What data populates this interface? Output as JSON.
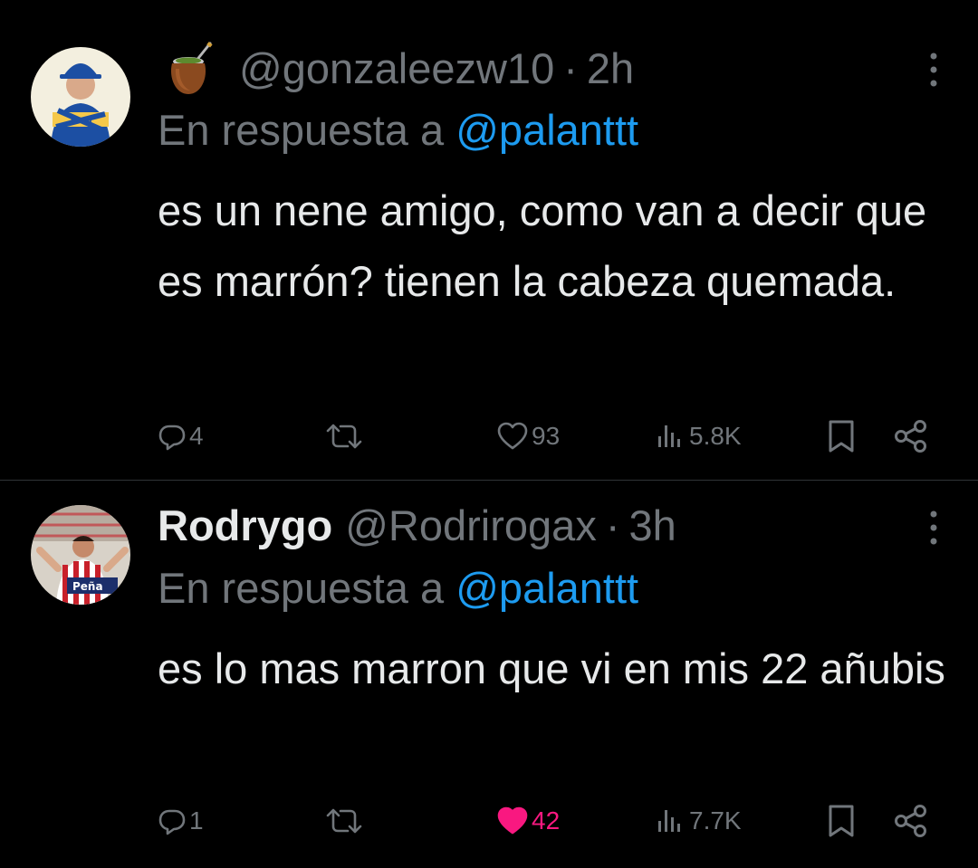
{
  "tweets": [
    {
      "display_name": "",
      "handle": "@gonzaleezw10",
      "separator": "·",
      "time": "2h",
      "reply_prefix": "En respuesta a ",
      "reply_to": "@palanttt",
      "text": "es un nene amigo, como van a decir que es marrón? tienen la cabeza quemada.",
      "replies": "4",
      "retweets": "",
      "likes": "93",
      "liked": false,
      "views": "5.8K",
      "avatar_colors": [
        "#f3efdf",
        "#1c4fa3",
        "#f5c84a"
      ]
    },
    {
      "display_name": "Rodrygo",
      "handle": "@Rodrirogax",
      "separator": "·",
      "time": "3h",
      "reply_prefix": "En respuesta a ",
      "reply_to": "@palanttt",
      "text": "es lo mas marron que vi en mis 22 añubis",
      "replies": "1",
      "retweets": "",
      "likes": "42",
      "liked": true,
      "views": "7.7K",
      "avatar_colors": [
        "#d8d2c8",
        "#c8202a",
        "#1c2f6b"
      ]
    }
  ],
  "colors": {
    "background": "#000000",
    "text": "#e7e9ea",
    "muted": "#71767b",
    "mention": "#1d9bf0",
    "like_active": "#f91880",
    "divider": "#2f3336"
  },
  "icons": [
    "mate-emoji-icon",
    "more-icon",
    "reply-icon",
    "retweet-icon",
    "like-icon",
    "views-icon",
    "bookmark-icon",
    "share-icon"
  ]
}
